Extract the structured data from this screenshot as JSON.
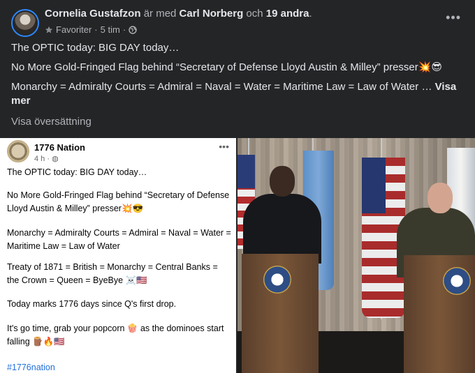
{
  "header": {
    "author": "Cornelia Gustafzon",
    "connector": "är med",
    "tagged": "Carl Norberg",
    "and": "och",
    "others": "19 andra",
    "period": ".",
    "audience": "Favoriter",
    "time": "5 tim",
    "separator": "·"
  },
  "post": {
    "line1": "The OPTIC today: BIG DAY today…",
    "line2": "No More Gold-Fringed Flag behind “Secretary of Defense Lloyd Austin & Milley” presser💥😎",
    "line3": "Monarchy = Admiralty Courts = Admiral = Naval = Water = Maritime Law = Law of Water …",
    "see_more": "Visa mer",
    "translate": "Visa översättning"
  },
  "shared_card": {
    "name": "1776 Nation",
    "time": "4 h",
    "separator": "·",
    "p1": "The OPTIC today: BIG DAY today…",
    "p2": "No More Gold-Fringed Flag behind “Secretary of Defense Lloyd Austin & Milley” presser💥😎",
    "p3": "Monarchy = Admiralty Courts = Admiral = Naval = Water = Maritime Law = Law of Water",
    "p4": "Treaty of 1871 = British = Monarchy = Central Banks = the Crown = Queen = ByeBye ☠️🇺🇸",
    "p5": "Today marks 1776 days since Q's first drop.",
    "p6": "It's go time, grab your popcorn 🍿 as the dominoes start falling 🪵🔥🇺🇸",
    "hashtag": "#1776nation"
  },
  "icons": {
    "more": "more-options-icon",
    "star": "star-icon",
    "globe": "globe-icon"
  },
  "colors": {
    "background": "#242526",
    "text": "#e4e6eb",
    "muted": "#b0b3b8",
    "link": "#216fdb"
  }
}
